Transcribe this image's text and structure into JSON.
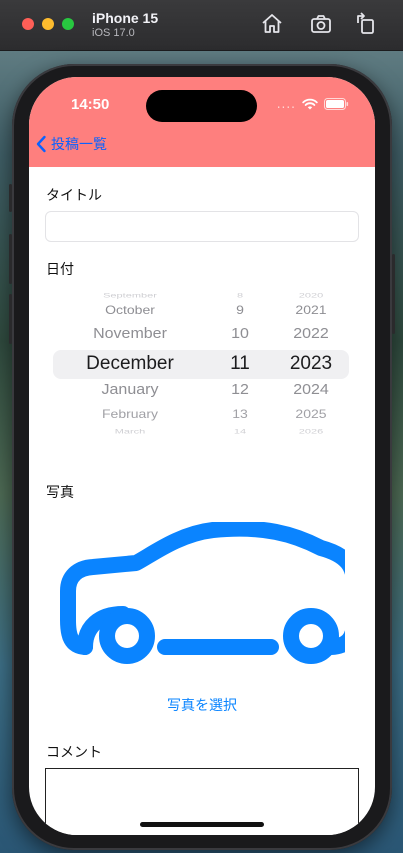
{
  "simulator": {
    "device": "iPhone 15",
    "os": "iOS 17.0",
    "icons": [
      "home-icon",
      "screenshot-icon",
      "rotate-icon"
    ]
  },
  "status_bar": {
    "time": "14:50",
    "dots": "....",
    "icons": [
      "wifi-icon",
      "battery-icon"
    ]
  },
  "nav": {
    "back_label": "投稿一覧",
    "color": "#fe7f7e",
    "accent": "#0a62ff"
  },
  "form": {
    "title_label": "タイトル",
    "title_value": "",
    "date_label": "日付",
    "photo_label": "写真",
    "select_photo_label": "写真を選択",
    "comment_label": "コメント",
    "comment_value": ""
  },
  "date_picker": {
    "rows": [
      {
        "month": "September",
        "day": "8",
        "year": "2020"
      },
      {
        "month": "October",
        "day": "9",
        "year": "2021"
      },
      {
        "month": "November",
        "day": "10",
        "year": "2022"
      },
      {
        "month": "December",
        "day": "11",
        "year": "2023"
      },
      {
        "month": "January",
        "day": "12",
        "year": "2024"
      },
      {
        "month": "February",
        "day": "13",
        "year": "2025"
      },
      {
        "month": "March",
        "day": "14",
        "year": "2026"
      }
    ],
    "selected": {
      "month": "December",
      "day": "11",
      "year": "2023"
    }
  },
  "photo": {
    "icon": "car-icon",
    "color": "#0a84ff"
  }
}
